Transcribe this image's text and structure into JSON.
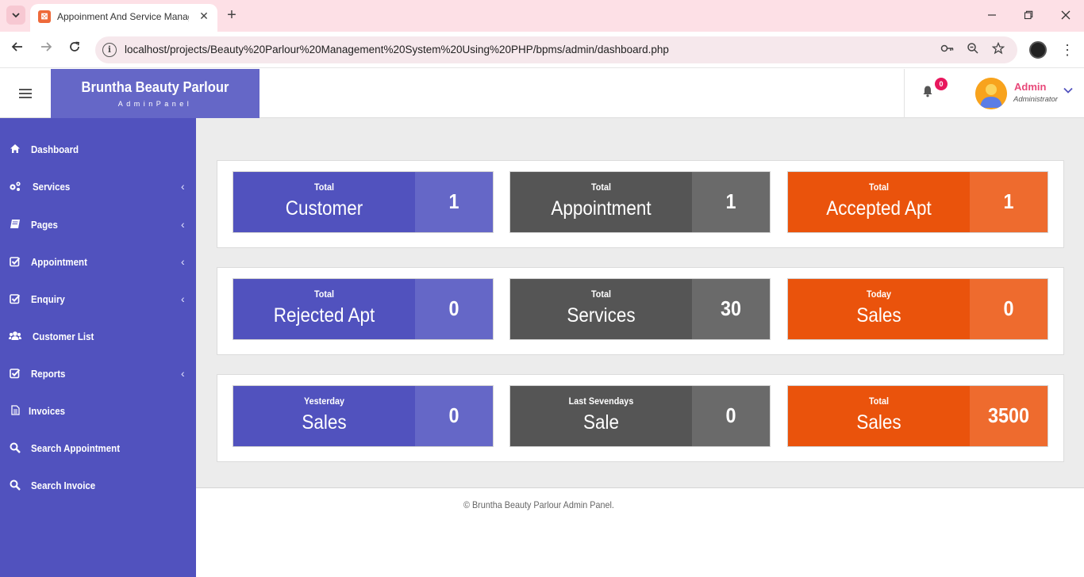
{
  "browser": {
    "tab_title": "Appoinment And Service Management",
    "tab_close": "✕",
    "new_tab": "+",
    "url": "localhost/projects/Beauty%20Parlour%20Management%20System%20Using%20PHP/bpms/admin/dashboard.php"
  },
  "header": {
    "brand_title": "Bruntha Beauty Parlour",
    "brand_subtitle": "AdminPanel",
    "notification_count": "0",
    "user_name": "Admin",
    "user_role": "Administrator"
  },
  "sidebar": {
    "items": [
      {
        "label": "Dashboard",
        "icon": "home-icon",
        "has_submenu": false
      },
      {
        "label": "Services",
        "icon": "cogs-icon",
        "has_submenu": true
      },
      {
        "label": "Pages",
        "icon": "book-icon",
        "has_submenu": true
      },
      {
        "label": "Appointment",
        "icon": "check-square-icon",
        "has_submenu": true
      },
      {
        "label": "Enquiry",
        "icon": "check-square-icon",
        "has_submenu": true
      },
      {
        "label": "Customer List",
        "icon": "users-icon",
        "has_submenu": false
      },
      {
        "label": "Reports",
        "icon": "check-square-icon",
        "has_submenu": true
      },
      {
        "label": "Invoices",
        "icon": "file-icon",
        "has_submenu": false
      },
      {
        "label": "Search Appointment",
        "icon": "search-icon",
        "has_submenu": false
      },
      {
        "label": "Search Invoice",
        "icon": "search-icon",
        "has_submenu": false
      }
    ]
  },
  "cards": {
    "total_customer": {
      "small": "Total",
      "big": "Customer",
      "value": "1"
    },
    "total_appointment": {
      "small": "Total",
      "big": "Appointment",
      "value": "1"
    },
    "total_accepted": {
      "small": "Total",
      "big": "Accepted Apt",
      "value": "1"
    },
    "total_rejected": {
      "small": "Total",
      "big": "Rejected Apt",
      "value": "0"
    },
    "total_services": {
      "small": "Total",
      "big": "Services",
      "value": "30"
    },
    "today_sales": {
      "small": "Today",
      "big": "Sales",
      "value": "0"
    },
    "yesterday_sales": {
      "small": "Yesterday",
      "big": "Sales",
      "value": "0"
    },
    "last_seven_days_sale": {
      "small": "Last Sevendays",
      "big": "Sale",
      "value": "0"
    },
    "total_sales": {
      "small": "Total",
      "big": "Sales",
      "value": "3500"
    }
  },
  "footer": {
    "copyright": "© Bruntha Beauty Parlour Admin Panel."
  },
  "colors": {
    "sidebar": "#5152be",
    "brand": "#6567c7",
    "card_blue": "#5152be",
    "card_gray": "#555555",
    "card_orange": "#ea530c",
    "badge": "#e8175d",
    "user_name": "#e8497a"
  }
}
